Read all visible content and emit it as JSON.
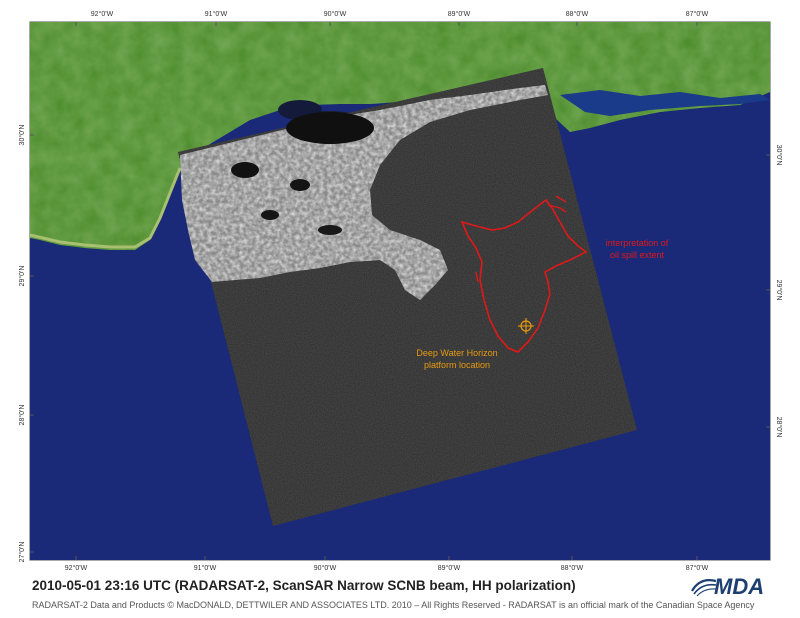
{
  "map": {
    "longitude_ticks": [
      "92°0'W",
      "91°0'W",
      "90°0'W",
      "89°0'W",
      "88°0'W",
      "87°0'W"
    ],
    "latitude_ticks": [
      "30°0'N",
      "29°0'N",
      "28°0'N",
      "27°0'N"
    ],
    "annotations": {
      "spill_label_line1": "interpretation of",
      "spill_label_line2": "oil spill extent",
      "platform_label_line1": "Deep Water Horizon",
      "platform_label_line2": "platform location"
    },
    "colors": {
      "ocean": "#1a2a78",
      "land": "#4e8a2c",
      "sar_swath": "#2a2a2a",
      "spill_outline": "#e01818",
      "spill_label": "#e01818",
      "platform_label": "#e89a10"
    },
    "icons": {
      "platform": "crosshair-target-icon",
      "logo": "mda-logo"
    }
  },
  "caption": "2010-05-01 23:16 UTC (RADARSAT-2, ScanSAR Narrow SCNB beam, HH polarization)",
  "credits": "RADARSAT-2 Data and Products © MacDONALD, DETTWILER AND ASSOCIATES LTD. 2010 – All Rights Reserved - RADARSAT is an official mark of the Canadian Space Agency",
  "logo_text": "MDA"
}
